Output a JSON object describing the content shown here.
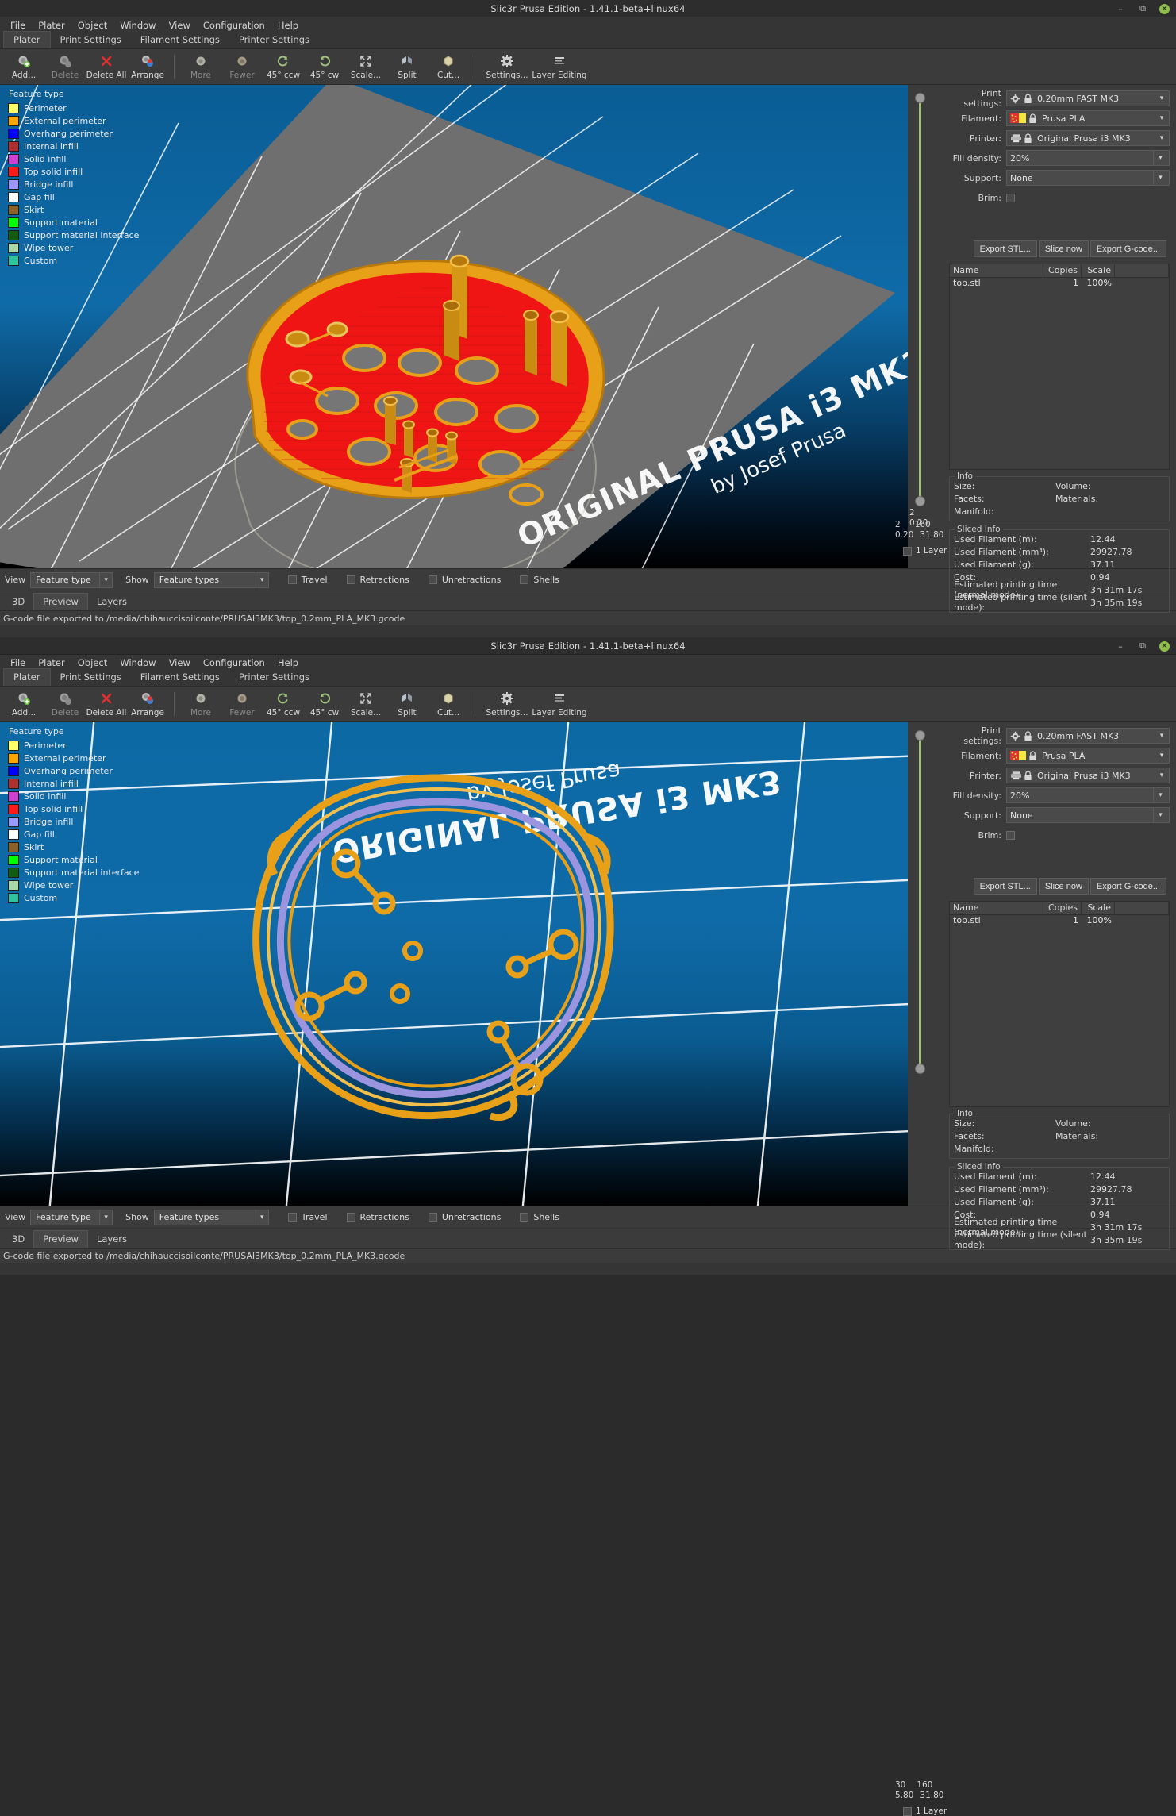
{
  "window": {
    "title": "Slic3r Prusa Edition - 1.41.1-beta+linux64",
    "minimize": "–",
    "maximize": "❐",
    "close": "✕"
  },
  "menubar": [
    "File",
    "Plater",
    "Object",
    "Window",
    "View",
    "Configuration",
    "Help"
  ],
  "tabs": [
    {
      "label": "Plater",
      "active": true
    },
    {
      "label": "Print Settings",
      "active": false
    },
    {
      "label": "Filament Settings",
      "active": false
    },
    {
      "label": "Printer Settings",
      "active": false
    }
  ],
  "toolbar": [
    {
      "label": "Add...",
      "icon": "add-icon",
      "disabled": false
    },
    {
      "label": "Delete",
      "icon": "delete-icon",
      "disabled": true
    },
    {
      "label": "Delete All",
      "icon": "delete-all-icon",
      "disabled": false
    },
    {
      "label": "Arrange",
      "icon": "arrange-icon",
      "disabled": false
    },
    {
      "label": "More",
      "icon": "more-icon",
      "disabled": true
    },
    {
      "label": "Fewer",
      "icon": "fewer-icon",
      "disabled": true
    },
    {
      "label": "45° ccw",
      "icon": "rotate-ccw-icon",
      "disabled": true
    },
    {
      "label": "45° cw",
      "icon": "rotate-cw-icon",
      "disabled": true
    },
    {
      "label": "Scale...",
      "icon": "scale-icon",
      "disabled": true
    },
    {
      "label": "Split",
      "icon": "split-icon",
      "disabled": true
    },
    {
      "label": "Cut...",
      "icon": "cut-icon",
      "disabled": true
    },
    {
      "label": "Settings...",
      "icon": "settings-icon",
      "disabled": true
    },
    {
      "label": "Layer Editing",
      "icon": "layer-editing-icon",
      "disabled": false
    }
  ],
  "legend": {
    "title": "Feature type",
    "items": [
      {
        "label": "Perimeter",
        "color": "#ffff66"
      },
      {
        "label": "External perimeter",
        "color": "#ffa500"
      },
      {
        "label": "Overhang perimeter",
        "color": "#0000ff"
      },
      {
        "label": "Internal infill",
        "color": "#b03030"
      },
      {
        "label": "Solid infill",
        "color": "#d040d0"
      },
      {
        "label": "Top solid infill",
        "color": "#ff1a1a"
      },
      {
        "label": "Bridge infill",
        "color": "#9999ff"
      },
      {
        "label": "Gap fill",
        "color": "#ffffff"
      },
      {
        "label": "Skirt",
        "color": "#8a6228"
      },
      {
        "label": "Support material",
        "color": "#00ff00"
      },
      {
        "label": "Support material interface",
        "color": "#115c11"
      },
      {
        "label": "Wipe tower",
        "color": "#a8d8a8"
      },
      {
        "label": "Custom",
        "color": "#2ec4a0"
      }
    ]
  },
  "plate_text": {
    "line1": "ORIGINAL PRUSA i3 MK3",
    "line2": "by Josef Prusa"
  },
  "slider_top": {
    "upper_layer": "160",
    "upper_z": "31.80",
    "lower_layer": "2",
    "lower_z": "0.20",
    "one_layer_label": "1 Layer"
  },
  "slider_bottom": {
    "upper_layer": "160",
    "upper_z": "31.80",
    "lower_layer": "30",
    "lower_z": "5.80",
    "one_layer_label": "1 Layer"
  },
  "sidepanel": {
    "rows": [
      {
        "label": "Print settings:",
        "value": "0.20mm FAST MK3",
        "icon": "gear-lock-icon",
        "split": false
      },
      {
        "label": "Filament:",
        "value": "Prusa PLA",
        "icon": "filament-lock-icon",
        "split": false
      },
      {
        "label": "Printer:",
        "value": "Original Prusa i3 MK3",
        "icon": "printer-lock-icon",
        "split": false
      },
      {
        "label": "Fill density:",
        "value": "20%",
        "icon": "",
        "split": true
      },
      {
        "label": "Support:",
        "value": "None",
        "icon": "",
        "split": true
      }
    ],
    "brim_label": "Brim:",
    "buttons": [
      {
        "label": "Export STL..."
      },
      {
        "label": "Slice now"
      },
      {
        "label": "Export G-code..."
      }
    ],
    "objlist": {
      "headers": [
        "Name",
        "Copies",
        "Scale",
        ""
      ],
      "rows": [
        {
          "name": "top.stl",
          "copies": "1",
          "scale": "100%"
        }
      ]
    },
    "info": {
      "title": "Info",
      "size_label": "Size:",
      "size_value": "",
      "volume_label": "Volume:",
      "volume_value": "",
      "facets_label": "Facets:",
      "facets_value": "",
      "materials_label": "Materials:",
      "materials_value": "",
      "manifold_label": "Manifold:",
      "manifold_value": ""
    },
    "sliced_info": {
      "title": "Sliced Info",
      "rows": [
        {
          "key": "Used Filament (m):",
          "value": "12.44"
        },
        {
          "key": "Used Filament (mm³):",
          "value": "29927.78"
        },
        {
          "key": "Used Filament (g):",
          "value": "37.11"
        },
        {
          "key": "Cost:",
          "value": "0.94"
        },
        {
          "key": "Estimated printing time (normal mode):",
          "value": "3h 31m 17s"
        },
        {
          "key": "Estimated printing time (silent mode):",
          "value": "3h 35m 19s"
        }
      ]
    }
  },
  "viewbar": {
    "view_label": "View",
    "view_value": "Feature type",
    "show_label": "Show",
    "show_value": "Feature types",
    "checks": [
      {
        "label": "Travel",
        "checked": false
      },
      {
        "label": "Retractions",
        "checked": false
      },
      {
        "label": "Unretractions",
        "checked": false
      },
      {
        "label": "Shells",
        "checked": false
      }
    ]
  },
  "bottom_tabs": [
    {
      "label": "3D",
      "active": false
    },
    {
      "label": "Preview",
      "active": true
    },
    {
      "label": "Layers",
      "active": false
    }
  ],
  "statusbar": {
    "text": "G-code file exported to /media/chihauccisoilconte/PRUSAI3MK3/top_0.2mm_PLA_MK3.gcode"
  },
  "colors": {
    "accent_green": "#8fbf4a",
    "panel_bg": "#3b3b3b",
    "viewport_sky": "#0f6ba8",
    "model_red": "#ff1a1a",
    "model_orange": "#f0a020"
  }
}
